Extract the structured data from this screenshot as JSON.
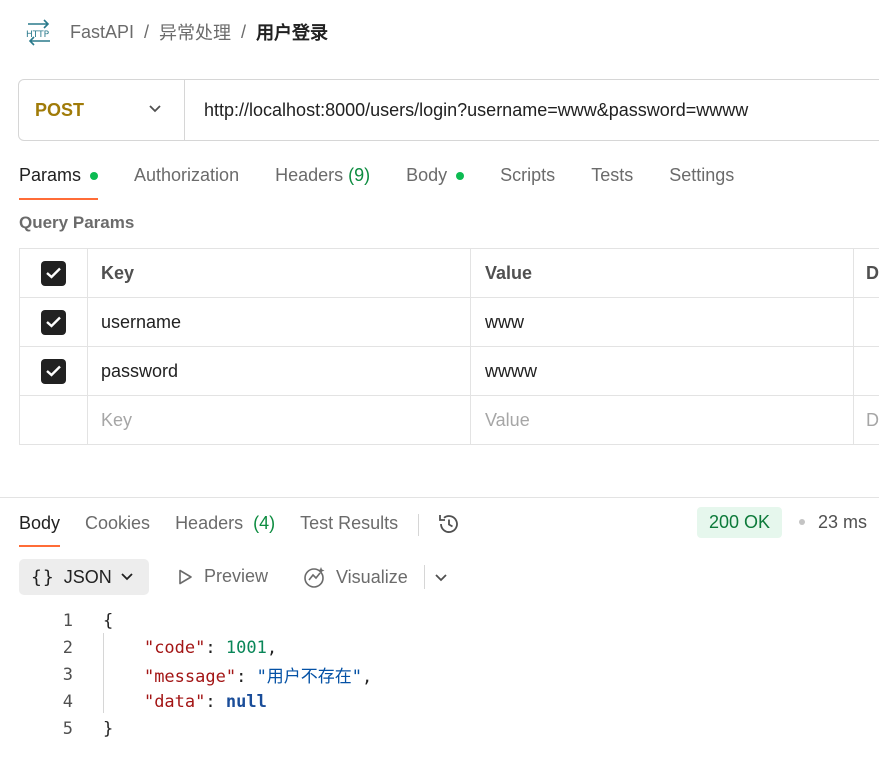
{
  "breadcrumb": {
    "icon": "http-icon",
    "items": [
      "FastAPI",
      "异常处理"
    ],
    "separator": "/",
    "current": "用户登录"
  },
  "request": {
    "method": "POST",
    "method_color": "#a07b08",
    "url": "http://localhost:8000/users/login?username=www&password=wwww"
  },
  "request_tabs": {
    "params": "Params",
    "authorization": "Authorization",
    "headers": "Headers",
    "headers_count": "(9)",
    "body": "Body",
    "scripts": "Scripts",
    "tests": "Tests",
    "settings": "Settings"
  },
  "query_params": {
    "title": "Query Params",
    "columns": {
      "key": "Key",
      "value": "Value",
      "desc": "D"
    },
    "rows": [
      {
        "key": "username",
        "value": "www",
        "checked": true
      },
      {
        "key": "password",
        "value": "wwww",
        "checked": true
      }
    ],
    "placeholder": {
      "key": "Key",
      "value": "Value",
      "desc": "D"
    }
  },
  "response_tabs": {
    "body": "Body",
    "cookies": "Cookies",
    "headers": "Headers",
    "headers_count": "(4)",
    "test_results": "Test Results"
  },
  "response_meta": {
    "status": "200 OK",
    "time": "23 ms"
  },
  "format_toolbar": {
    "braces": "{}",
    "format": "JSON",
    "preview": "Preview",
    "visualize": "Visualize"
  },
  "response_body": {
    "line_numbers": [
      "1",
      "2",
      "3",
      "4",
      "5"
    ],
    "open": "{",
    "close": "}",
    "fields": [
      {
        "key": "\"code\"",
        "value": "1001",
        "type": "number",
        "trail": ","
      },
      {
        "key": "\"message\"",
        "value": "\"用户不存在\"",
        "type": "string",
        "trail": ","
      },
      {
        "key": "\"data\"",
        "value": "null",
        "type": "keyword",
        "trail": ""
      }
    ]
  },
  "colors": {
    "accent": "#ff6c37",
    "dot_green": "#0cbb52",
    "status_bg": "#e6f7ed",
    "status_text": "#0d7a3a"
  }
}
